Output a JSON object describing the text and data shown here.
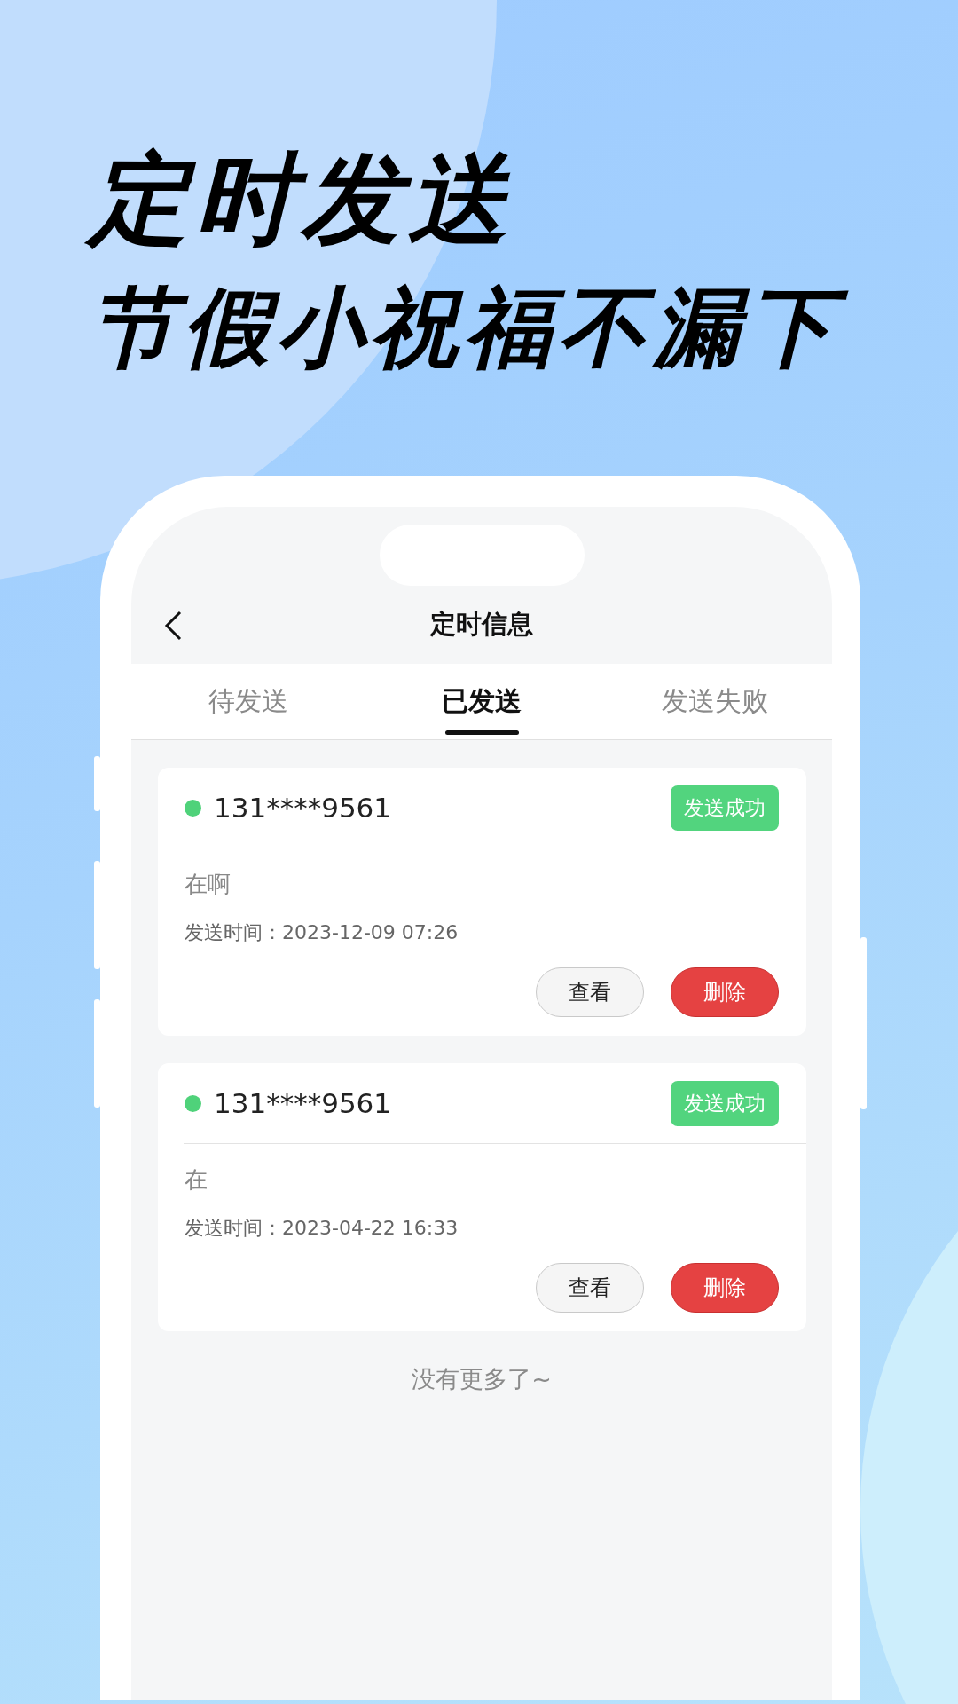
{
  "headline": [
    "定时发送",
    "节假小祝福不漏下"
  ],
  "screen": {
    "title": "定时信息"
  },
  "tabs": [
    {
      "label": "待发送",
      "selected": false
    },
    {
      "label": "已发送",
      "selected": true
    },
    {
      "label": "发送失败",
      "selected": false
    }
  ],
  "messages": [
    {
      "phone": "131****9561",
      "color": "#4fd27a",
      "status": "发送成功",
      "text": "在啊",
      "time": "发送时间：2023-12-09 07:26",
      "actions": [
        {
          "label": "查看",
          "kind": "view"
        },
        {
          "label": "删除",
          "kind": "delete"
        }
      ]
    },
    {
      "phone": "131****9561",
      "color": "#4fd27a",
      "status": "发送成功",
      "text": "在",
      "time": "发送时间：2023-04-22 16:33",
      "actions": [
        {
          "label": "查看",
          "kind": "view"
        },
        {
          "label": "删除",
          "kind": "delete"
        }
      ]
    }
  ],
  "footer": "没有更多了~"
}
